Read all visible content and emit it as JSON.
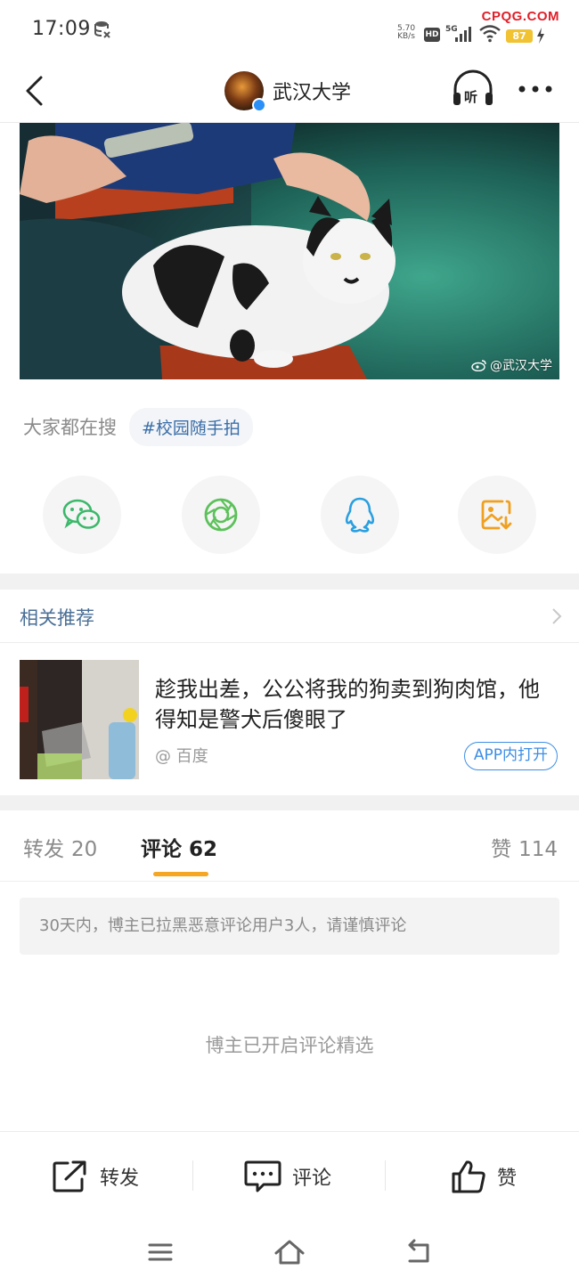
{
  "status_bar": {
    "time": "17:09",
    "net_speed_value": "5.70",
    "net_speed_unit": "KB/s",
    "hd": "HD",
    "network": "5G",
    "battery": "87",
    "watermark": "CPQG.COM"
  },
  "header": {
    "title": "武汉大学"
  },
  "post": {
    "image_watermark": "@武汉大学"
  },
  "search": {
    "label": "大家都在搜",
    "tag": "#校园随手拍"
  },
  "share": {
    "items": [
      "wechat-icon",
      "moments-icon",
      "qq-icon",
      "save-image-icon"
    ]
  },
  "related": {
    "title": "相关推荐",
    "card": {
      "title": "趁我出差，公公将我的狗卖到狗肉馆，他得知是警犬后傻眼了",
      "source": "@ 百度",
      "open_label": "APP内打开"
    }
  },
  "tabs": {
    "repost_label": "转发",
    "repost_count": "20",
    "comment_label": "评论",
    "comment_count": "62",
    "like_label": "赞",
    "like_count": "114"
  },
  "comments": {
    "notice": "30天内，博主已拉黑恶意评论用户3人，请谨慎评论",
    "featured": "博主已开启评论精选"
  },
  "actions": {
    "repost": "转发",
    "comment": "评论",
    "like": "赞"
  },
  "colors": {
    "accent": "#f5a623",
    "link": "#3d8ee5",
    "related_title": "#4a6f96",
    "wechat": "#3bb86a",
    "moments": "#5cc15a",
    "qq": "#2a9fe0",
    "save": "#f0a020"
  }
}
